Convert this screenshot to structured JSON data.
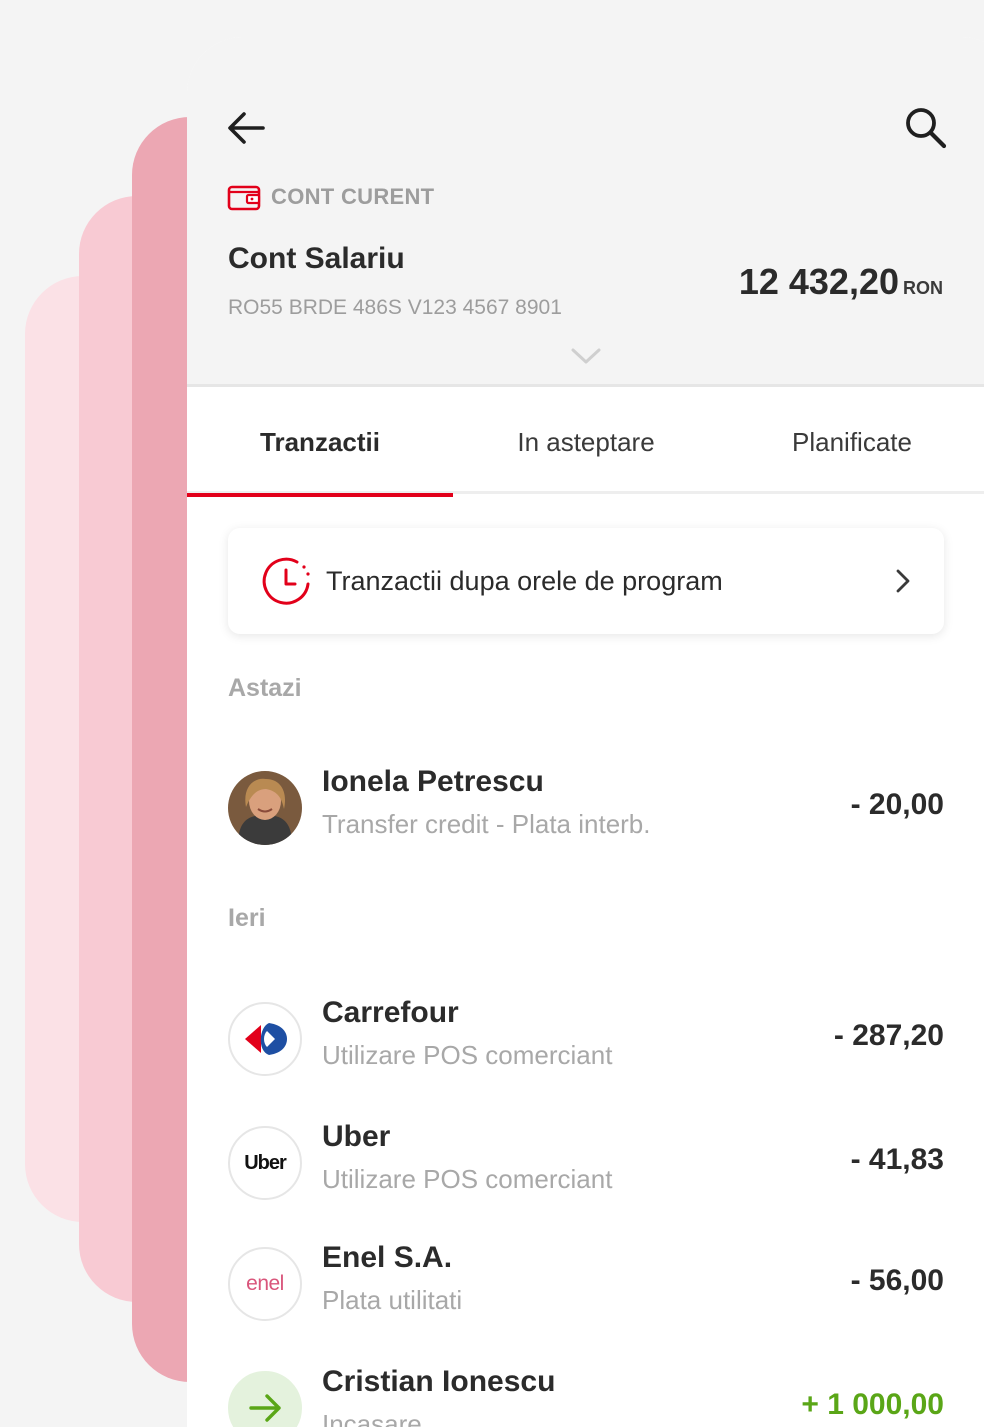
{
  "header": {
    "account_type": "CONT CURENT",
    "account_name": "Cont Salariu",
    "iban": "RO55 BRDE 486S V123 4567 8901",
    "balance": "12 432,20",
    "currency": "RON"
  },
  "tabs": [
    {
      "label": "Tranzactii",
      "active": true
    },
    {
      "label": "In asteptare",
      "active": false
    },
    {
      "label": "Planificate",
      "active": false
    }
  ],
  "banner": {
    "label": "Tranzactii dupa orele de program"
  },
  "sections": {
    "today": "Astazi",
    "yesterday": "Ieri"
  },
  "transactions": [
    {
      "name": "Ionela Petrescu",
      "description": "Transfer credit - Plata interb.",
      "amount": "- 20,00",
      "icon": "person-photo"
    },
    {
      "name": "Carrefour",
      "description": "Utilizare POS comerciant",
      "amount": "- 287,20",
      "icon": "carrefour-logo"
    },
    {
      "name": "Uber",
      "description": "Utilizare POS comerciant",
      "amount": "- 41,83",
      "icon": "uber-logo",
      "logo_text": "Uber"
    },
    {
      "name": "Enel S.A.",
      "description": "Plata utilitati",
      "amount": "- 56,00",
      "icon": "enel-logo",
      "logo_text": "enel"
    },
    {
      "name": "Cristian Ionescu",
      "description": "Incasare",
      "amount": "+ 1 000,00",
      "icon": "incoming-arrow"
    }
  ],
  "colors": {
    "accent": "#e2001a",
    "positive": "#5aa617",
    "muted": "#a8a8a8",
    "text": "#2b2b2b"
  }
}
